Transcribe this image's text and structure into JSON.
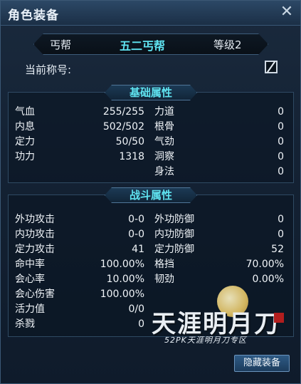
{
  "window": {
    "title": "角色装备"
  },
  "header": {
    "sect": "丐帮",
    "name": "五二丐帮",
    "level": "等级2"
  },
  "title_row": {
    "label": "当前称号:"
  },
  "basic": {
    "banner": "基础属性",
    "left": [
      {
        "label": "气血",
        "value": "255/255"
      },
      {
        "label": "内息",
        "value": "502/502"
      },
      {
        "label": "定力",
        "value": "50/50"
      },
      {
        "label": "功力",
        "value": "1318"
      }
    ],
    "right": [
      {
        "label": "力道",
        "value": "0"
      },
      {
        "label": "根骨",
        "value": "0"
      },
      {
        "label": "气劲",
        "value": "0"
      },
      {
        "label": "洞察",
        "value": "0"
      },
      {
        "label": "身法",
        "value": "0"
      }
    ]
  },
  "combat": {
    "banner": "战斗属性",
    "left": [
      {
        "label": "外功攻击",
        "value": "0-0"
      },
      {
        "label": "内功攻击",
        "value": "0-0"
      },
      {
        "label": "定力攻击",
        "value": "41"
      },
      {
        "label": "命中率",
        "value": "100.00%"
      },
      {
        "label": "会心率",
        "value": "10.00%"
      },
      {
        "label": "会心伤害",
        "value": "100.00%"
      },
      {
        "label": "活力值",
        "value": "0/0"
      },
      {
        "label": "杀戮",
        "value": "0"
      }
    ],
    "right": [
      {
        "label": "外功防御",
        "value": "0"
      },
      {
        "label": "内功防御",
        "value": "0"
      },
      {
        "label": "定力防御",
        "value": "52"
      },
      {
        "label": "格挡",
        "value": "70.00%"
      },
      {
        "label": "韧劲",
        "value": "0.00%"
      }
    ]
  },
  "watermark": {
    "logo_text": "天涯明月刀",
    "sub_text": "52PK天涯明月刀专区"
  },
  "buttons": {
    "hide_equipment": "隐藏装备"
  },
  "icons": {
    "close": "close-icon",
    "checkbox": "checkbox-icon"
  }
}
